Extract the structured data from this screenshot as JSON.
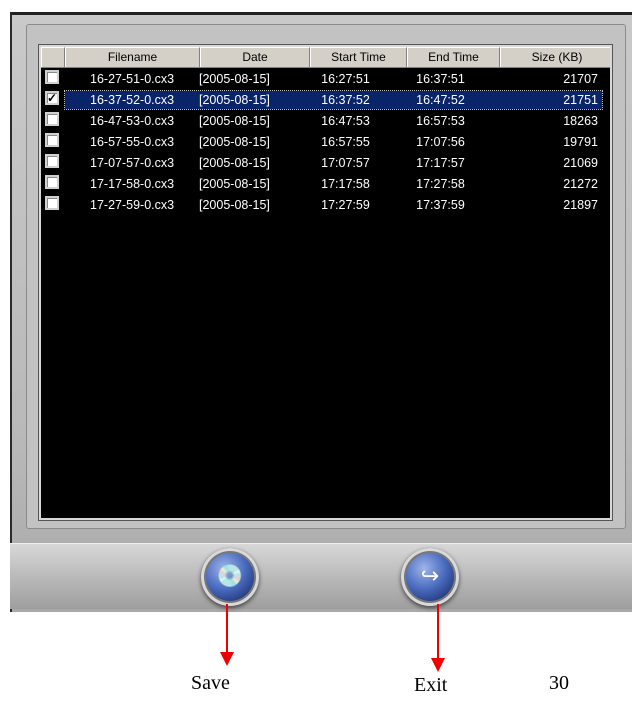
{
  "table": {
    "columns": [
      "",
      "Filename",
      "Date",
      "Start Time",
      "End Time",
      "Size (KB)"
    ],
    "rows": [
      {
        "checked": false,
        "filename": "16-27-51-0.cx3",
        "date": "[2005-08-15]",
        "start": "16:27:51",
        "end": "16:37:51",
        "size": "21707"
      },
      {
        "checked": true,
        "filename": "16-37-52-0.cx3",
        "date": "[2005-08-15]",
        "start": "16:37:52",
        "end": "16:47:52",
        "size": "21751"
      },
      {
        "checked": false,
        "filename": "16-47-53-0.cx3",
        "date": "[2005-08-15]",
        "start": "16:47:53",
        "end": "16:57:53",
        "size": "18263"
      },
      {
        "checked": false,
        "filename": "16-57-55-0.cx3",
        "date": "[2005-08-15]",
        "start": "16:57:55",
        "end": "17:07:56",
        "size": "19791"
      },
      {
        "checked": false,
        "filename": "17-07-57-0.cx3",
        "date": "[2005-08-15]",
        "start": "17:07:57",
        "end": "17:17:57",
        "size": "21069"
      },
      {
        "checked": false,
        "filename": "17-17-58-0.cx3",
        "date": "[2005-08-15]",
        "start": "17:17:58",
        "end": "17:27:58",
        "size": "21272"
      },
      {
        "checked": false,
        "filename": "17-27-59-0.cx3",
        "date": "[2005-08-15]",
        "start": "17:27:59",
        "end": "17:37:59",
        "size": "21897"
      }
    ],
    "selected_row": 1
  },
  "buttons": {
    "save_icon": "disk-save-icon",
    "exit_icon": "exit-arrow-icon"
  },
  "captions": {
    "save": "Save",
    "exit": "Exit",
    "page_number": "30"
  },
  "colors": {
    "list_background": "#000000",
    "selection": "#0a246a",
    "callout_arrow": "#e00000"
  }
}
